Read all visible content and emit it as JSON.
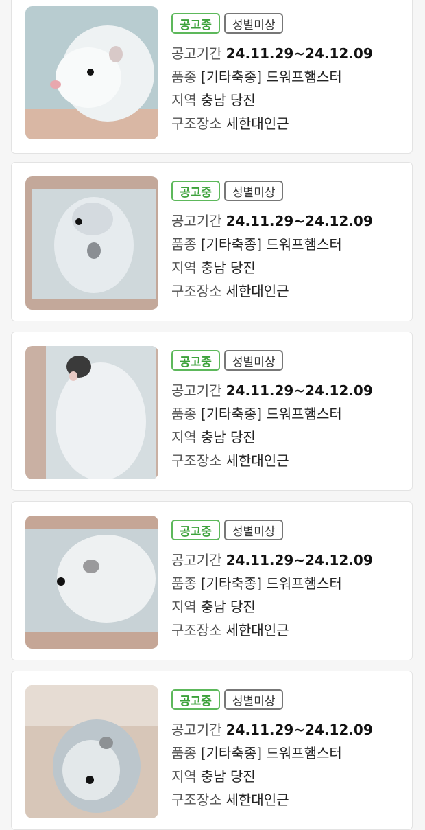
{
  "colors": {
    "notice_green": "#3da23b",
    "card_bg": "#ffffff",
    "page_bg": "#f6f6f6"
  },
  "listings": [
    {
      "photo_icon": "hamster-photo",
      "status_badge": "공고중",
      "sex_badge": "성별미상",
      "period_label": "공고기간",
      "period_value": "24.11.29~24.12.09",
      "breed_label": "품종",
      "breed_value": "[기타축종] 드워프햄스터",
      "region_label": "지역",
      "region_value": "충남 당진",
      "place_label": "구조장소",
      "place_value": "세한대인근"
    },
    {
      "photo_icon": "hamster-photo",
      "status_badge": "공고중",
      "sex_badge": "성별미상",
      "period_label": "공고기간",
      "period_value": "24.11.29~24.12.09",
      "breed_label": "품종",
      "breed_value": "[기타축종] 드워프햄스터",
      "region_label": "지역",
      "region_value": "충남 당진",
      "place_label": "구조장소",
      "place_value": "세한대인근"
    },
    {
      "photo_icon": "hamster-photo",
      "status_badge": "공고중",
      "sex_badge": "성별미상",
      "period_label": "공고기간",
      "period_value": "24.11.29~24.12.09",
      "breed_label": "품종",
      "breed_value": "[기타축종] 드워프햄스터",
      "region_label": "지역",
      "region_value": "충남 당진",
      "place_label": "구조장소",
      "place_value": "세한대인근"
    },
    {
      "photo_icon": "hamster-photo",
      "status_badge": "공고중",
      "sex_badge": "성별미상",
      "period_label": "공고기간",
      "period_value": "24.11.29~24.12.09",
      "breed_label": "품종",
      "breed_value": "[기타축종] 드워프햄스터",
      "region_label": "지역",
      "region_value": "충남 당진",
      "place_label": "구조장소",
      "place_value": "세한대인근"
    },
    {
      "photo_icon": "hamster-photo",
      "status_badge": "공고중",
      "sex_badge": "성별미상",
      "period_label": "공고기간",
      "period_value": "24.11.29~24.12.09",
      "breed_label": "품종",
      "breed_value": "[기타축종] 드워프햄스터",
      "region_label": "지역",
      "region_value": "충남 당진",
      "place_label": "구조장소",
      "place_value": "세한대인근"
    }
  ]
}
